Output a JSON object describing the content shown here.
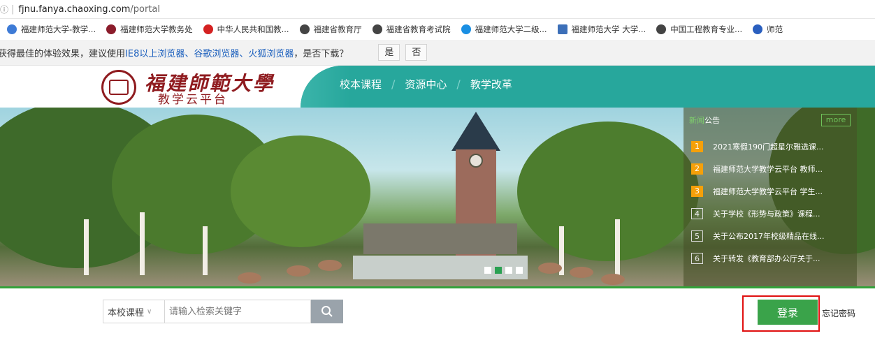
{
  "browser": {
    "security_glyph": "ⓘ",
    "url_host": "fjnu.fanya.chaoxing.com",
    "url_path": "/portal"
  },
  "bookmarks": [
    {
      "label": "福建师范大学-教学...",
      "icon": "globe-icon",
      "color": "#3e7bd6"
    },
    {
      "label": "福建师范大学教务处",
      "icon": "seal-icon",
      "color": "#8b1c2b"
    },
    {
      "label": "中华人民共和国教...",
      "icon": "ministry-icon",
      "color": "#d42121"
    },
    {
      "label": "福建省教育厅",
      "icon": "globe-icon",
      "color": "#444444"
    },
    {
      "label": "福建省教育考试院",
      "icon": "globe-icon",
      "color": "#444444"
    },
    {
      "label": "福建师范大学二级...",
      "icon": "heart-icon",
      "color": "#1a8fe3"
    },
    {
      "label": "福建师范大学 大学...",
      "icon": "monitor-icon",
      "color": "#3c6fb8"
    },
    {
      "label": "中国工程教育专业...",
      "icon": "globe-icon",
      "color": "#444444"
    },
    {
      "label": "师范",
      "icon": "seal-icon",
      "color": "#2a5fbf"
    }
  ],
  "notice": {
    "prefix": "获得最佳的体验效果，建议使用",
    "browsers": "IE8以上浏览器、谷歌浏览器、火狐浏览器",
    "suffix": "，是否下载？",
    "yes": "是",
    "no": "否"
  },
  "site": {
    "logo_title": "福建師範大學",
    "logo_subtitle": "教学云平台",
    "nav": [
      "校本课程",
      "资源中心",
      "教学改革"
    ]
  },
  "announcements": {
    "tab_a": "新闻",
    "tab_b": "公告",
    "more": "more",
    "items": [
      {
        "num": "1",
        "title": "2021寒假190门超星尔雅选课..."
      },
      {
        "num": "2",
        "title": "福建师范大学教学云平台 教师..."
      },
      {
        "num": "3",
        "title": "福建师范大学教学云平台 学生..."
      },
      {
        "num": "4",
        "title": "关于学校《形势与政策》课程..."
      },
      {
        "num": "5",
        "title": "关于公布2017年校级精品在线..."
      },
      {
        "num": "6",
        "title": "关于转发《教育部办公厅关于..."
      }
    ]
  },
  "search": {
    "scope": "本校课程",
    "placeholder": "请输入检索关键字"
  },
  "auth": {
    "login": "登录",
    "forgot": "忘记密码"
  }
}
